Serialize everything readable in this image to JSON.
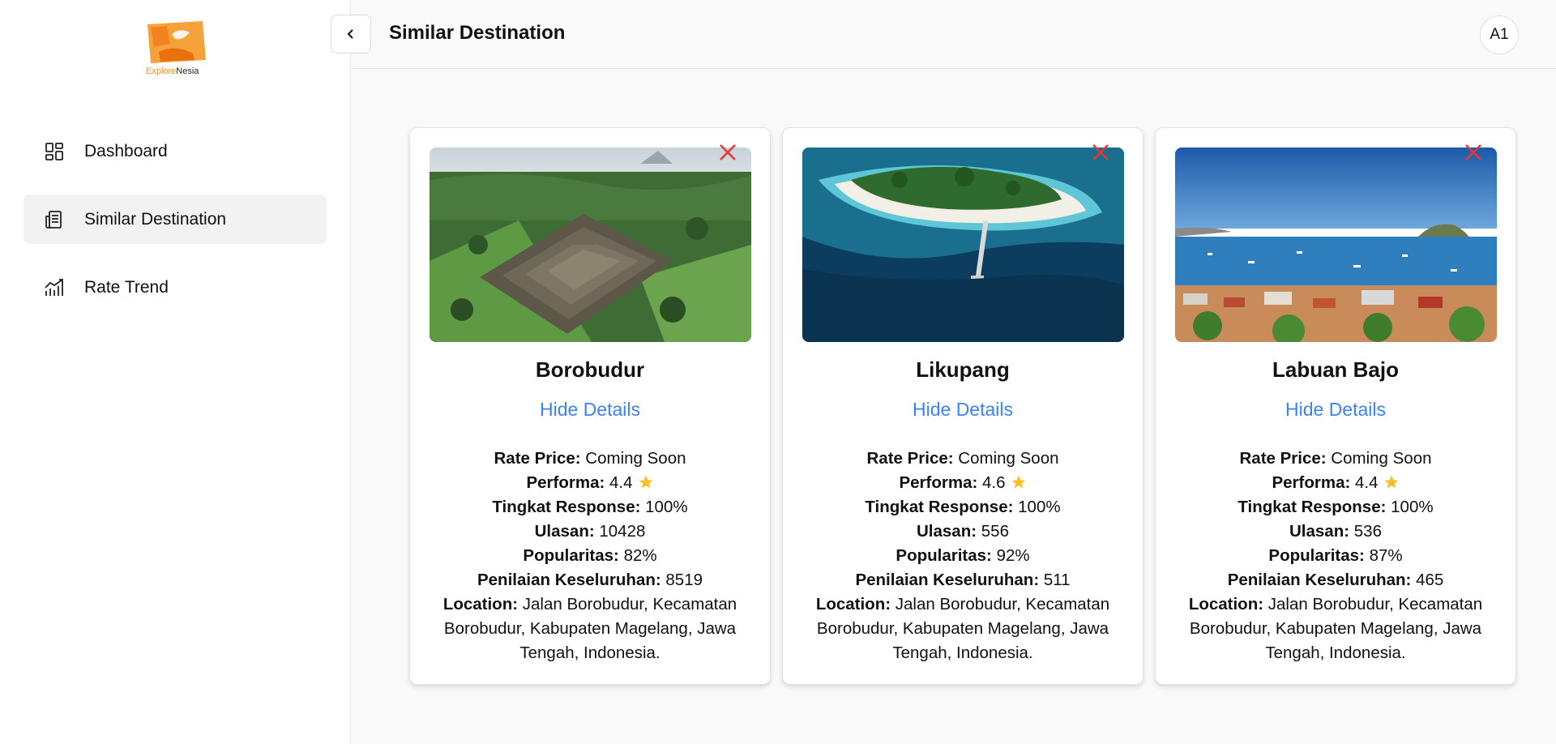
{
  "brand": {
    "logo_part1": "Explore",
    "logo_part2": "Nesia"
  },
  "sidebar": {
    "items": [
      {
        "label": "Dashboard",
        "icon": "dashboard-grid-icon",
        "active": false
      },
      {
        "label": "Similar Destination",
        "icon": "document-list-icon",
        "active": true
      },
      {
        "label": "Rate Trend",
        "icon": "trend-chart-icon",
        "active": false
      }
    ]
  },
  "header": {
    "title": "Similar Destination",
    "avatar": "A1"
  },
  "cards": [
    {
      "name": "Borobudur",
      "toggle": "Hide Details",
      "rate_price_label": "Rate Price:",
      "rate_price": "Coming Soon",
      "performa_label": "Performa:",
      "performa": "4.4",
      "response_label": "Tingkat Response:",
      "response": "100%",
      "ulasan_label": "Ulasan:",
      "ulasan": "10428",
      "popularitas_label": "Popularitas:",
      "popularitas": "82%",
      "penilaian_label": "Penilaian Keseluruhan:",
      "penilaian": "8519",
      "location_label": "Location:",
      "location": "Jalan Borobudur, Kecamatan Borobudur, Kabupaten Magelang, Jawa Tengah, Indonesia."
    },
    {
      "name": "Likupang",
      "toggle": "Hide Details",
      "rate_price_label": "Rate Price:",
      "rate_price": "Coming Soon",
      "performa_label": "Performa:",
      "performa": "4.6",
      "response_label": "Tingkat Response:",
      "response": "100%",
      "ulasan_label": "Ulasan:",
      "ulasan": "556",
      "popularitas_label": "Popularitas:",
      "popularitas": "92%",
      "penilaian_label": "Penilaian Keseluruhan:",
      "penilaian": "511",
      "location_label": "Location:",
      "location": "Jalan Borobudur, Kecamatan Borobudur, Kabupaten Magelang, Jawa Tengah, Indonesia."
    },
    {
      "name": "Labuan Bajo",
      "toggle": "Hide Details",
      "rate_price_label": "Rate Price:",
      "rate_price": "Coming Soon",
      "performa_label": "Performa:",
      "performa": "4.4",
      "response_label": "Tingkat Response:",
      "response": "100%",
      "ulasan_label": "Ulasan:",
      "ulasan": "536",
      "popularitas_label": "Popularitas:",
      "popularitas": "87%",
      "penilaian_label": "Penilaian Keseluruhan:",
      "penilaian": "465",
      "location_label": "Location:",
      "location": "Jalan Borobudur, Kecamatan Borobudur, Kabupaten Magelang, Jawa Tengah, Indonesia."
    }
  ],
  "colors": {
    "accent": "#3b82f6",
    "close": "#e53935",
    "star": "#fbbf24",
    "active_bg": "#f2f2f2"
  }
}
